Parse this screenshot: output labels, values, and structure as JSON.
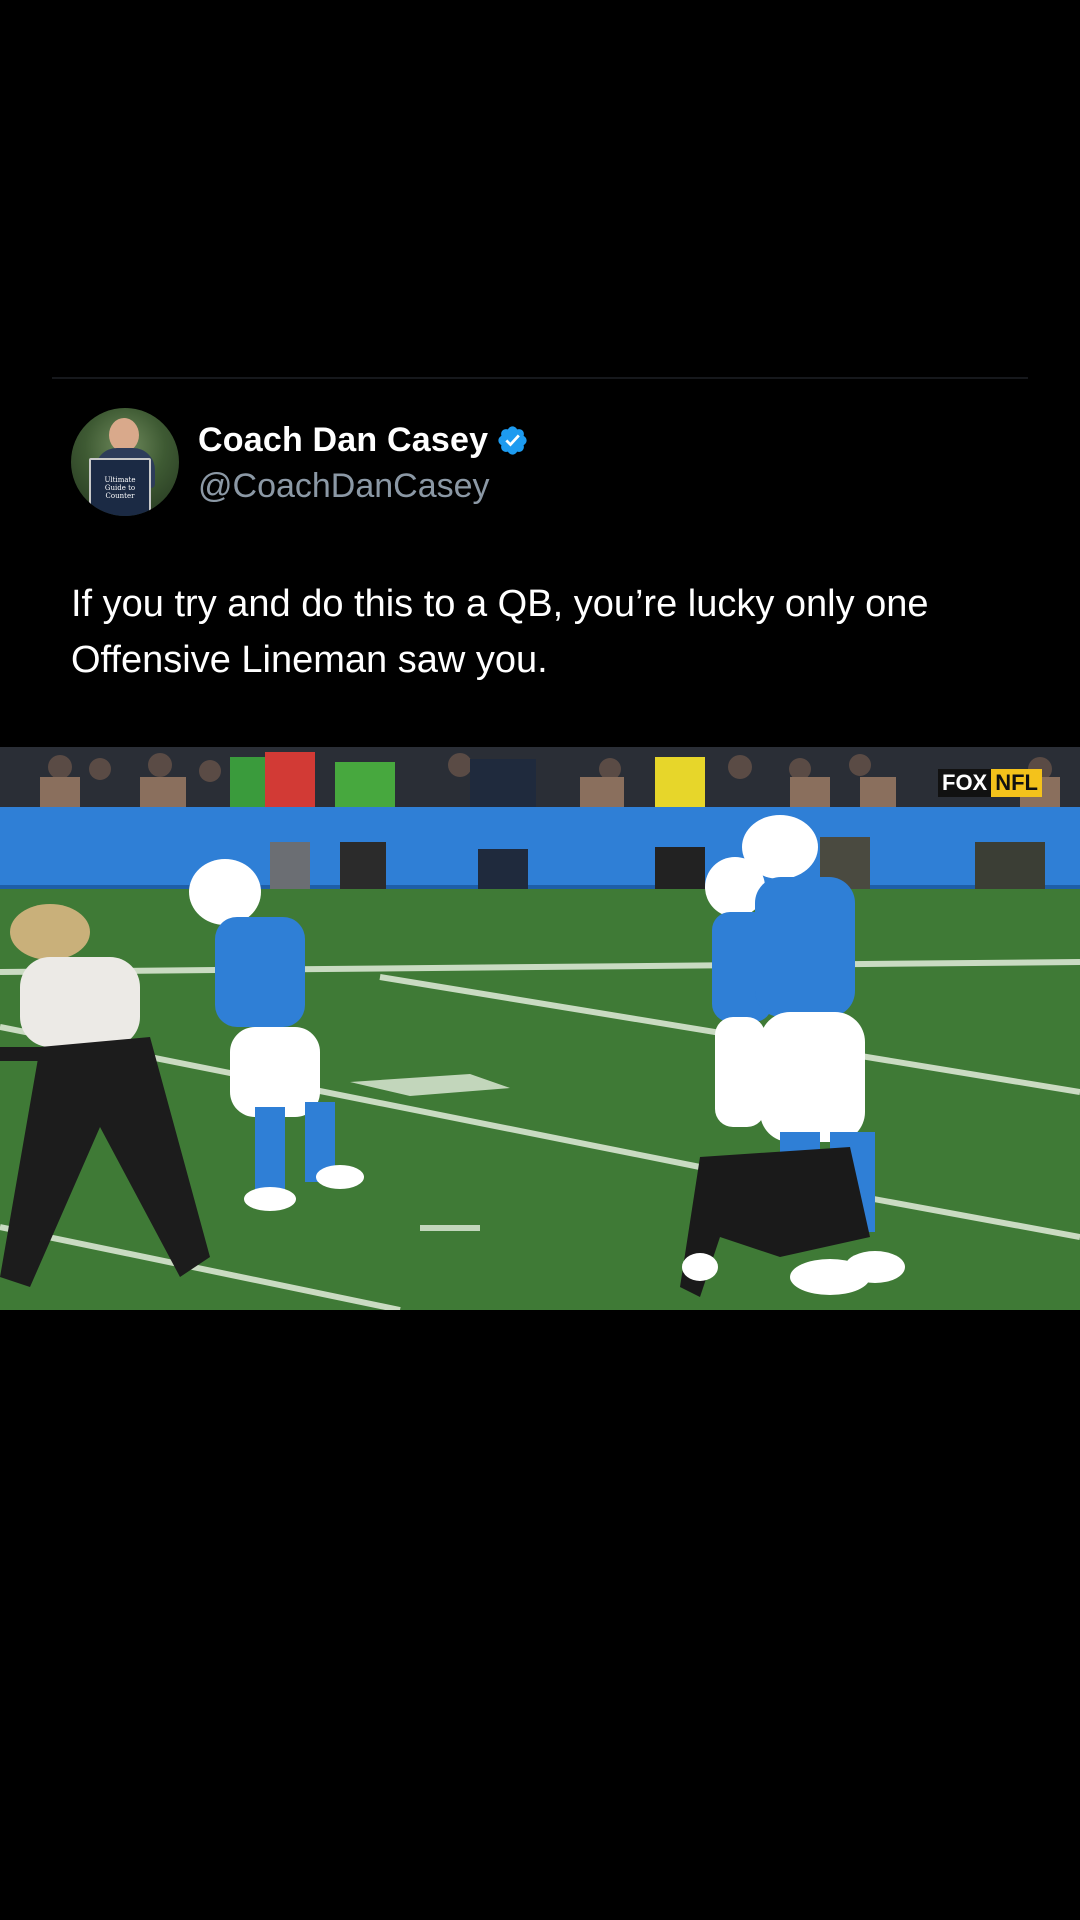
{
  "tweet": {
    "author": {
      "display_name": "Coach Dan Casey",
      "handle": "@CoachDanCasey",
      "verified": true,
      "avatar_book_text": [
        "Ultimate",
        "Guide to",
        "Counter"
      ]
    },
    "text_lines": [
      "If you try and do this to a QB, you’re lucky only one",
      "Offensive Lineman saw you."
    ]
  },
  "video": {
    "broadcast_logo": {
      "fox": "FOX",
      "nfl": "NFL"
    }
  },
  "colors": {
    "background": "#000000",
    "verified_badge": "#1d9bf0",
    "handle": "#8b98a5",
    "field_green": "#3f7a36",
    "chargers_blue": "#2f7fd6"
  },
  "icons": {
    "verified": "verified-badge-icon"
  }
}
